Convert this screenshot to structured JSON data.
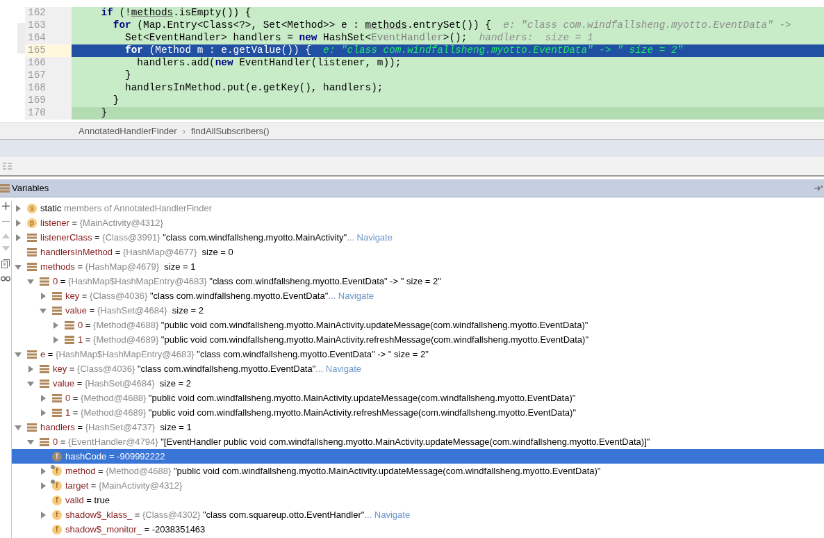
{
  "editor": {
    "lines": [
      {
        "number": "162",
        "selected": false,
        "segments": [
          {
            "kind": "kw",
            "text": "    if"
          },
          {
            "kind": "plain",
            "text": " (!"
          },
          {
            "kind": "ul",
            "text": "methods"
          },
          {
            "kind": "plain",
            "text": ".isEmpty()) {"
          }
        ]
      },
      {
        "number": "163",
        "selected": false,
        "segments": [
          {
            "kind": "kw",
            "text": "      for"
          },
          {
            "kind": "plain",
            "text": " (Map.Entry<Class<?>, Set<Method>> e : "
          },
          {
            "kind": "ul",
            "text": "methods"
          },
          {
            "kind": "plain",
            "text": ".entrySet()) {  "
          },
          {
            "kind": "hint",
            "text": "e: \"class com.windfallsheng.myotto.EventData\" ->"
          }
        ]
      },
      {
        "number": "164",
        "selected": false,
        "segments": [
          {
            "kind": "plain",
            "text": "        Set<EventHandler> handlers = "
          },
          {
            "kind": "kw",
            "text": "new"
          },
          {
            "kind": "plain",
            "text": " HashSet<"
          },
          {
            "kind": "generic",
            "text": "EventHandler"
          },
          {
            "kind": "plain",
            "text": ">();  "
          },
          {
            "kind": "hint",
            "text": "handlers:  size = 1"
          }
        ]
      },
      {
        "number": "165",
        "selected": true,
        "segments": [
          {
            "kind": "kw",
            "text": "        for"
          },
          {
            "kind": "plain",
            "text": " (Method m : e.getValue()) {  "
          },
          {
            "kind": "hint",
            "text": "e: \"class com.windfallsheng.myotto.EventData\" -> \" size = 2\""
          }
        ]
      },
      {
        "number": "166",
        "selected": false,
        "segments": [
          {
            "kind": "plain",
            "text": "          handlers.add("
          },
          {
            "kind": "kw",
            "text": "new"
          },
          {
            "kind": "plain",
            "text": " EventHandler(listener, m));"
          }
        ]
      },
      {
        "number": "167",
        "selected": false,
        "segments": [
          {
            "kind": "plain",
            "text": "        }"
          }
        ]
      },
      {
        "number": "168",
        "selected": false,
        "segments": [
          {
            "kind": "plain",
            "text": "        handlersInMethod.put(e.getKey(), handlers);"
          }
        ]
      },
      {
        "number": "169",
        "selected": false,
        "segments": [
          {
            "kind": "plain",
            "text": "      }"
          }
        ]
      },
      {
        "number": "170",
        "selected": false,
        "segments": [
          {
            "kind": "plain",
            "text": "    }"
          }
        ]
      }
    ]
  },
  "breadcrumb": [
    "AnnotatedHandlerFinder",
    "findAllSubscribers()"
  ],
  "breadcrumb_separator": "›",
  "variables": {
    "title": "Variables",
    "tree": [
      {
        "kind": "static",
        "badge": "s",
        "name": "static",
        "description": "members of AnnotatedHandlerFinder",
        "expanded": false,
        "selected": false
      },
      {
        "kind": "param",
        "badge": "p",
        "name": "listener",
        "sign": "=",
        "type": "{MainActivity@4312}",
        "expanded": false,
        "selected": false
      },
      {
        "kind": "object",
        "name": "listenerClass",
        "sign": "=",
        "type": "{Class@3991}",
        "value": "\"class com.windfallsheng.myotto.MainActivity\"",
        "link": "... Navigate",
        "expanded": false,
        "selected": false
      },
      {
        "kind": "object",
        "name": "handlersInMethod",
        "sign": "=",
        "type": "{HashMap@4677}",
        "value": " size = 0",
        "selected": false
      },
      {
        "kind": "object",
        "name": "methods",
        "sign": "=",
        "type": "{HashMap@4679}",
        "value": " size = 1",
        "expanded": true,
        "selected": false,
        "children": [
          {
            "kind": "object",
            "name": "0",
            "sign": "=",
            "type": "{HashMap$HashMapEntry@4683}",
            "value": "\"class com.windfallsheng.myotto.EventData\" -> \" size = 2\"",
            "expanded": true,
            "selected": false,
            "children": [
              {
                "kind": "object",
                "name": "key",
                "sign": "=",
                "type": "{Class@4036}",
                "value": "\"class com.windfallsheng.myotto.EventData\"",
                "link": "... Navigate",
                "expanded": false,
                "selected": false
              },
              {
                "kind": "object",
                "name": "value",
                "sign": "=",
                "type": "{HashSet@4684}",
                "value": " size = 2",
                "expanded": true,
                "selected": false,
                "children": [
                  {
                    "kind": "object",
                    "name": "0",
                    "sign": "=",
                    "type": "{Method@4688}",
                    "value": "\"public void com.windfallsheng.myotto.MainActivity.updateMessage(com.windfallsheng.myotto.EventData)\"",
                    "expanded": false,
                    "selected": false
                  },
                  {
                    "kind": "object",
                    "name": "1",
                    "sign": "=",
                    "type": "{Method@4689}",
                    "value": "\"public void com.windfallsheng.myotto.MainActivity.refreshMessage(com.windfallsheng.myotto.EventData)\"",
                    "expanded": false,
                    "selected": false
                  }
                ]
              }
            ]
          }
        ]
      },
      {
        "kind": "object",
        "name": "e",
        "sign": "=",
        "type": "{HashMap$HashMapEntry@4683}",
        "value": "\"class com.windfallsheng.myotto.EventData\" -> \" size = 2\"",
        "expanded": true,
        "selected": false,
        "children": [
          {
            "kind": "object",
            "name": "key",
            "sign": "=",
            "type": "{Class@4036}",
            "value": "\"class com.windfallsheng.myotto.EventData\"",
            "link": "... Navigate",
            "expanded": false,
            "selected": false
          },
          {
            "kind": "object",
            "name": "value",
            "sign": "=",
            "type": "{HashSet@4684}",
            "value": " size = 2",
            "expanded": true,
            "selected": false,
            "children": [
              {
                "kind": "object",
                "name": "0",
                "sign": "=",
                "type": "{Method@4688}",
                "value": "\"public void com.windfallsheng.myotto.MainActivity.updateMessage(com.windfallsheng.myotto.EventData)\"",
                "expanded": false,
                "selected": false
              },
              {
                "kind": "object",
                "name": "1",
                "sign": "=",
                "type": "{Method@4689}",
                "value": "\"public void com.windfallsheng.myotto.MainActivity.refreshMessage(com.windfallsheng.myotto.EventData)\"",
                "expanded": false,
                "selected": false
              }
            ]
          }
        ]
      },
      {
        "kind": "object",
        "name": "handlers",
        "sign": "=",
        "type": "{HashSet@4737}",
        "value": " size = 1",
        "expanded": true,
        "selected": false,
        "children": [
          {
            "kind": "object",
            "name": "0",
            "sign": "=",
            "type": "{EventHandler@4794}",
            "value": "\"[EventHandler public void com.windfallsheng.myotto.MainActivity.updateMessage(com.windfallsheng.myotto.EventData)]\"",
            "expanded": true,
            "selected": false,
            "children": [
              {
                "kind": "field",
                "badge": "f",
                "name": "hashCode",
                "sign": "=",
                "value": "-909992222",
                "selected": true
              },
              {
                "kind": "field",
                "badge": "f",
                "locked": true,
                "name": "method",
                "sign": "=",
                "type": "{Method@4688}",
                "value": "\"public void com.windfallsheng.myotto.MainActivity.updateMessage(com.windfallsheng.myotto.EventData)\"",
                "expanded": false,
                "selected": false
              },
              {
                "kind": "field",
                "badge": "f",
                "locked": true,
                "name": "target",
                "sign": "=",
                "type": "{MainActivity@4312}",
                "expanded": false,
                "selected": false
              },
              {
                "kind": "field",
                "badge": "f",
                "name": "valid",
                "sign": "=",
                "value": "true",
                "selected": false
              },
              {
                "kind": "field",
                "badge": "f",
                "name": "shadow$_klass_",
                "sign": "=",
                "type": "{Class@4302}",
                "value": "\"class com.squareup.otto.EventHandler\"",
                "link": "... Navigate",
                "expanded": false,
                "selected": false
              },
              {
                "kind": "field",
                "badge": "f",
                "name": "shadow$_monitor_",
                "sign": "=",
                "value": "-2038351463",
                "selected": false
              }
            ]
          }
        ]
      }
    ]
  }
}
